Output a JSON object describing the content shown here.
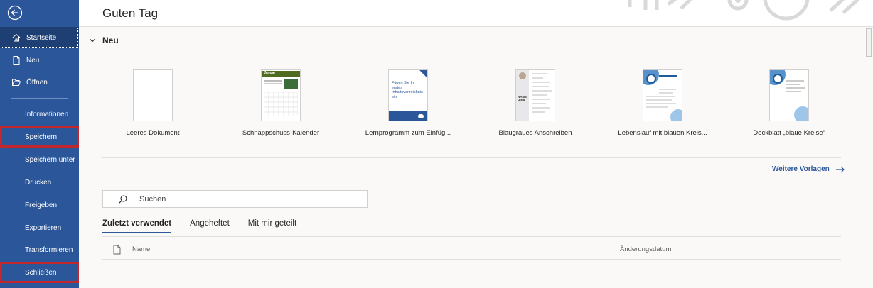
{
  "sidebar": {
    "items": [
      {
        "label": "Startseite"
      },
      {
        "label": "Neu"
      },
      {
        "label": "Öffnen"
      },
      {
        "label": "Informationen"
      },
      {
        "label": "Speichern"
      },
      {
        "label": "Speichern unter"
      },
      {
        "label": "Drucken"
      },
      {
        "label": "Freigeben"
      },
      {
        "label": "Exportieren"
      },
      {
        "label": "Transformieren"
      },
      {
        "label": "Schließen"
      }
    ]
  },
  "header": {
    "greeting": "Guten Tag"
  },
  "new_section": {
    "title": "Neu",
    "templates": [
      {
        "label": "Leeres Dokument"
      },
      {
        "label": "Schnappschuss-Kalender",
        "thumb_text": "Januar"
      },
      {
        "label": "Lernprogramm zum Einfüg...",
        "thumb_text": "Fügen Sie Ihr erstes Inhaltsverzeichnis ein"
      },
      {
        "label": "Blaugraues Anschreiben",
        "thumb_text": "NAME HIER"
      },
      {
        "label": "Lebenslauf mit blauen Kreis..."
      },
      {
        "label": "Deckblatt „blaue Kreise“"
      }
    ],
    "more_label": "Weitere Vorlagen"
  },
  "search": {
    "placeholder": "Suchen"
  },
  "tabs": [
    {
      "label": "Zuletzt verwendet"
    },
    {
      "label": "Angeheftet"
    },
    {
      "label": "Mit mir geteilt"
    }
  ],
  "table": {
    "columns": [
      "Name",
      "Änderungsdatum"
    ]
  },
  "colors": {
    "sidebar": "#2b579a",
    "highlight": "#c4262e",
    "accent": "#2b579a"
  }
}
